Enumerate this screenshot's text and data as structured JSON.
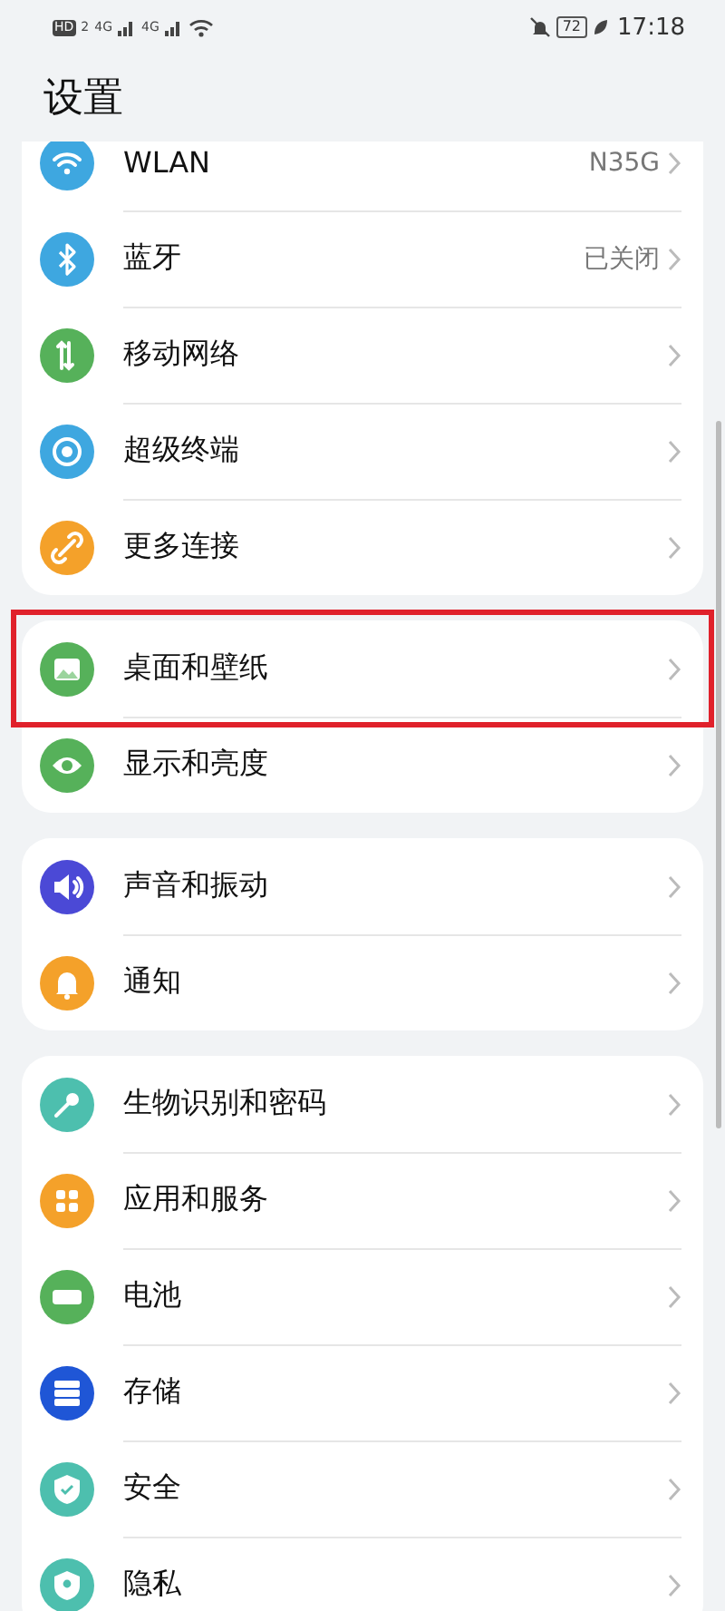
{
  "status_bar": {
    "hd": "HD",
    "sim": "2",
    "net1": "4G",
    "net2": "4G",
    "battery": "72",
    "time": "17:18"
  },
  "title": "设置",
  "groups": [
    {
      "items": [
        {
          "kind": "wifi",
          "label": "WLAN",
          "value": "N35G",
          "color": "#3ea7e0",
          "highlighted": false
        },
        {
          "kind": "bluetooth",
          "label": "蓝牙",
          "value": "已关闭",
          "color": "#3ea7e0",
          "highlighted": false
        },
        {
          "kind": "mobile",
          "label": "移动网络",
          "color": "#56b15a",
          "highlighted": false
        },
        {
          "kind": "terminal",
          "label": "超级终端",
          "color": "#3ea7e0",
          "highlighted": false
        },
        {
          "kind": "link",
          "label": "更多连接",
          "color": "#f4a12a",
          "highlighted": false
        }
      ]
    },
    {
      "items": [
        {
          "kind": "wallpaper",
          "label": "桌面和壁纸",
          "color": "#56b15a",
          "highlighted": true
        },
        {
          "kind": "eye",
          "label": "显示和亮度",
          "color": "#56b15a",
          "highlighted": false
        }
      ]
    },
    {
      "items": [
        {
          "kind": "sound",
          "label": "声音和振动",
          "color": "#4b49d6",
          "highlighted": false
        },
        {
          "kind": "bell",
          "label": "通知",
          "color": "#f4a12a",
          "highlighted": false
        }
      ]
    },
    {
      "items": [
        {
          "kind": "key",
          "label": "生物识别和密码",
          "color": "#4dbfae",
          "highlighted": false
        },
        {
          "kind": "apps",
          "label": "应用和服务",
          "color": "#f4a12a",
          "highlighted": false
        },
        {
          "kind": "battery",
          "label": "电池",
          "color": "#56b15a",
          "highlighted": false
        },
        {
          "kind": "storage",
          "label": "存储",
          "color": "#1f56d6",
          "highlighted": false
        },
        {
          "kind": "shield",
          "label": "安全",
          "color": "#4dbfae",
          "highlighted": false
        },
        {
          "kind": "privacy",
          "label": "隐私",
          "color": "#4dbfae",
          "highlighted": false
        }
      ]
    }
  ]
}
